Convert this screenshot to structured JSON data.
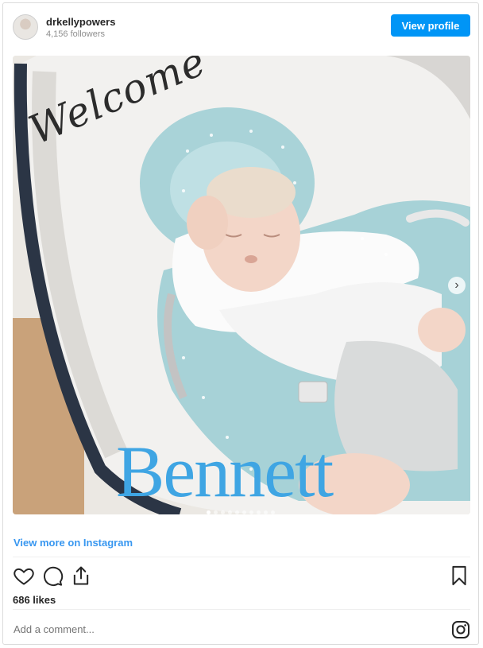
{
  "header": {
    "username": "drkellypowers",
    "followers": "4,156 followers",
    "view_profile_label": "View profile"
  },
  "post": {
    "overlay_welcome": "Welcome",
    "overlay_name": "Bennett",
    "carousel_dots": 10,
    "active_dot": 1
  },
  "links": {
    "view_more": "View more on Instagram"
  },
  "engagement": {
    "likes": "686 likes"
  },
  "comment": {
    "placeholder": "Add a comment..."
  },
  "icons": [
    "heart-icon",
    "comment-icon",
    "share-icon",
    "bookmark-icon",
    "instagram-icon",
    "chevron-right-icon"
  ],
  "colors": {
    "accent": "#0095f6",
    "link": "#3897f0",
    "name_overlay": "#3fa5e3"
  }
}
